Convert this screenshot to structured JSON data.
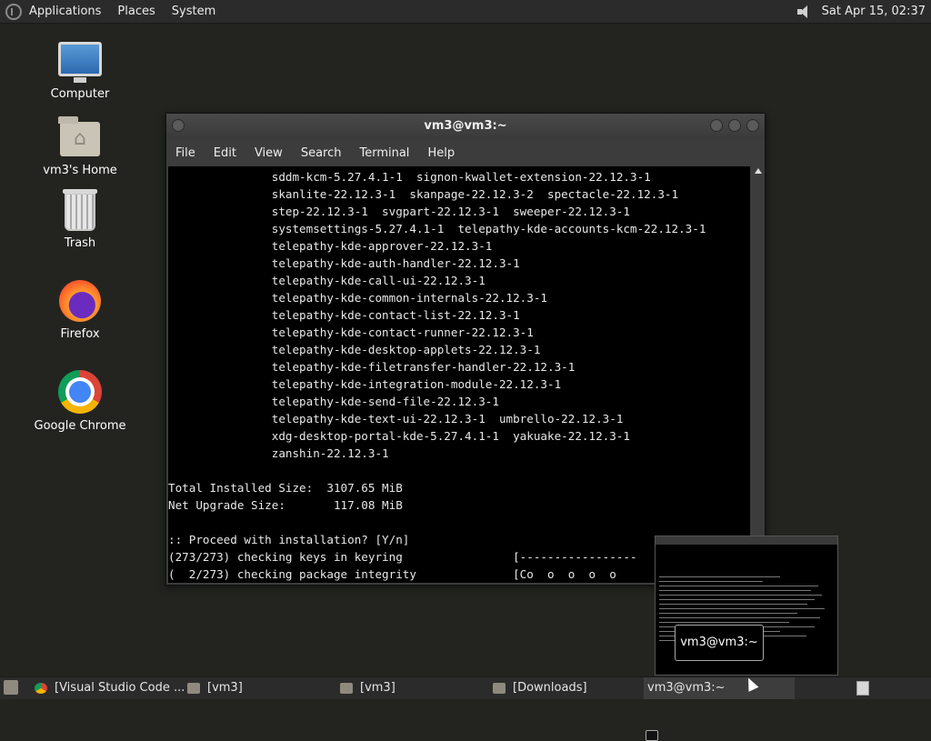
{
  "top_panel": {
    "menus": [
      "Applications",
      "Places",
      "System"
    ],
    "clock": "Sat Apr 15, 02:37"
  },
  "desktop_icons": [
    {
      "label": "Computer",
      "icon": "computer-icon"
    },
    {
      "label": "vm3's Home",
      "icon": "home-folder-icon"
    },
    {
      "label": "Trash",
      "icon": "trash-icon"
    },
    {
      "label": "Firefox",
      "icon": "firefox-icon"
    },
    {
      "label": "Google Chrome",
      "icon": "chrome-icon"
    }
  ],
  "terminal": {
    "title": "vm3@vm3:~",
    "menus": [
      "File",
      "Edit",
      "View",
      "Search",
      "Terminal",
      "Help"
    ],
    "lines": [
      "               sddm-kcm-5.27.4.1-1  signon-kwallet-extension-22.12.3-1",
      "               skanlite-22.12.3-1  skanpage-22.12.3-2  spectacle-22.12.3-1",
      "               step-22.12.3-1  svgpart-22.12.3-1  sweeper-22.12.3-1",
      "               systemsettings-5.27.4.1-1  telepathy-kde-accounts-kcm-22.12.3-1",
      "               telepathy-kde-approver-22.12.3-1",
      "               telepathy-kde-auth-handler-22.12.3-1",
      "               telepathy-kde-call-ui-22.12.3-1",
      "               telepathy-kde-common-internals-22.12.3-1",
      "               telepathy-kde-contact-list-22.12.3-1",
      "               telepathy-kde-contact-runner-22.12.3-1",
      "               telepathy-kde-desktop-applets-22.12.3-1",
      "               telepathy-kde-filetransfer-handler-22.12.3-1",
      "               telepathy-kde-integration-module-22.12.3-1",
      "               telepathy-kde-send-file-22.12.3-1",
      "               telepathy-kde-text-ui-22.12.3-1  umbrello-22.12.3-1",
      "               xdg-desktop-portal-kde-5.27.4.1-1  yakuake-22.12.3-1",
      "               zanshin-22.12.3-1",
      "",
      "Total Installed Size:  3107.65 MiB",
      "Net Upgrade Size:       117.08 MiB",
      "",
      ":: Proceed with installation? [Y/n]",
      "(273/273) checking keys in keyring                [-----------------",
      "(  2/273) checking package integrity              [Co  o  o  o  o"
    ]
  },
  "preview": {
    "label": "vm3@vm3:~"
  },
  "taskbar": {
    "tasks": [
      {
        "label": "[Visual Studio Code ...",
        "icon": "chrome-icon"
      },
      {
        "label": "[vm3]",
        "icon": "home-folder-icon"
      },
      {
        "label": "[vm3]",
        "icon": "home-folder-icon"
      },
      {
        "label": "[Downloads]",
        "icon": "folder-icon"
      },
      {
        "label": "vm3@vm3:~",
        "icon": "terminal-icon"
      }
    ]
  }
}
